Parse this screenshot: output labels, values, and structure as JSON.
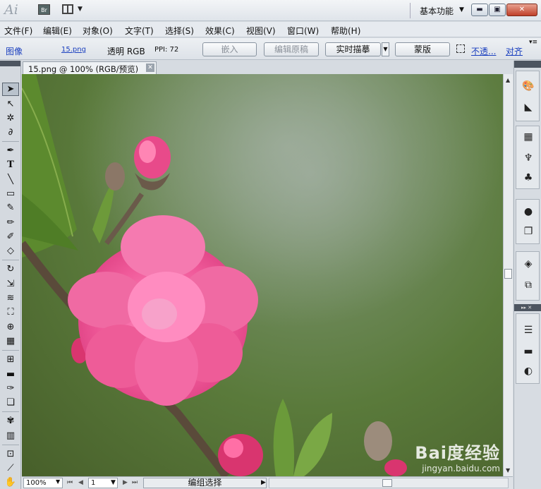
{
  "app": {
    "logo": "Ai",
    "bridge_label": "Br",
    "workspace_label": "基本功能"
  },
  "menu": [
    {
      "label": "文件(F)"
    },
    {
      "label": "编辑(E)"
    },
    {
      "label": "对象(O)"
    },
    {
      "label": "文字(T)"
    },
    {
      "label": "选择(S)"
    },
    {
      "label": "效果(C)"
    },
    {
      "label": "视图(V)"
    },
    {
      "label": "窗口(W)"
    },
    {
      "label": "帮助(H)"
    }
  ],
  "control": {
    "object_type": "图像",
    "file_link": "15.png",
    "mode": "透明 RGB",
    "ppi": "PPI: 72",
    "embed_button": "嵌入",
    "edit_original_button": "编辑原稿",
    "live_trace_button": "实时描摹",
    "mask_button": "蒙版",
    "opacity_link": "不透...",
    "align_link": "对齐"
  },
  "document": {
    "tab_title": "15.png @ 100% (RGB/预览)"
  },
  "statusbar": {
    "zoom": "100%",
    "page": "1",
    "status_text": "编组选择"
  },
  "watermark": {
    "logo": "Bai度经验",
    "url": "jingyan.baidu.com"
  },
  "colors": {
    "link_blue": "#1a3fbf",
    "panel_header": "#4d5560",
    "close_red": "#c0402a"
  }
}
